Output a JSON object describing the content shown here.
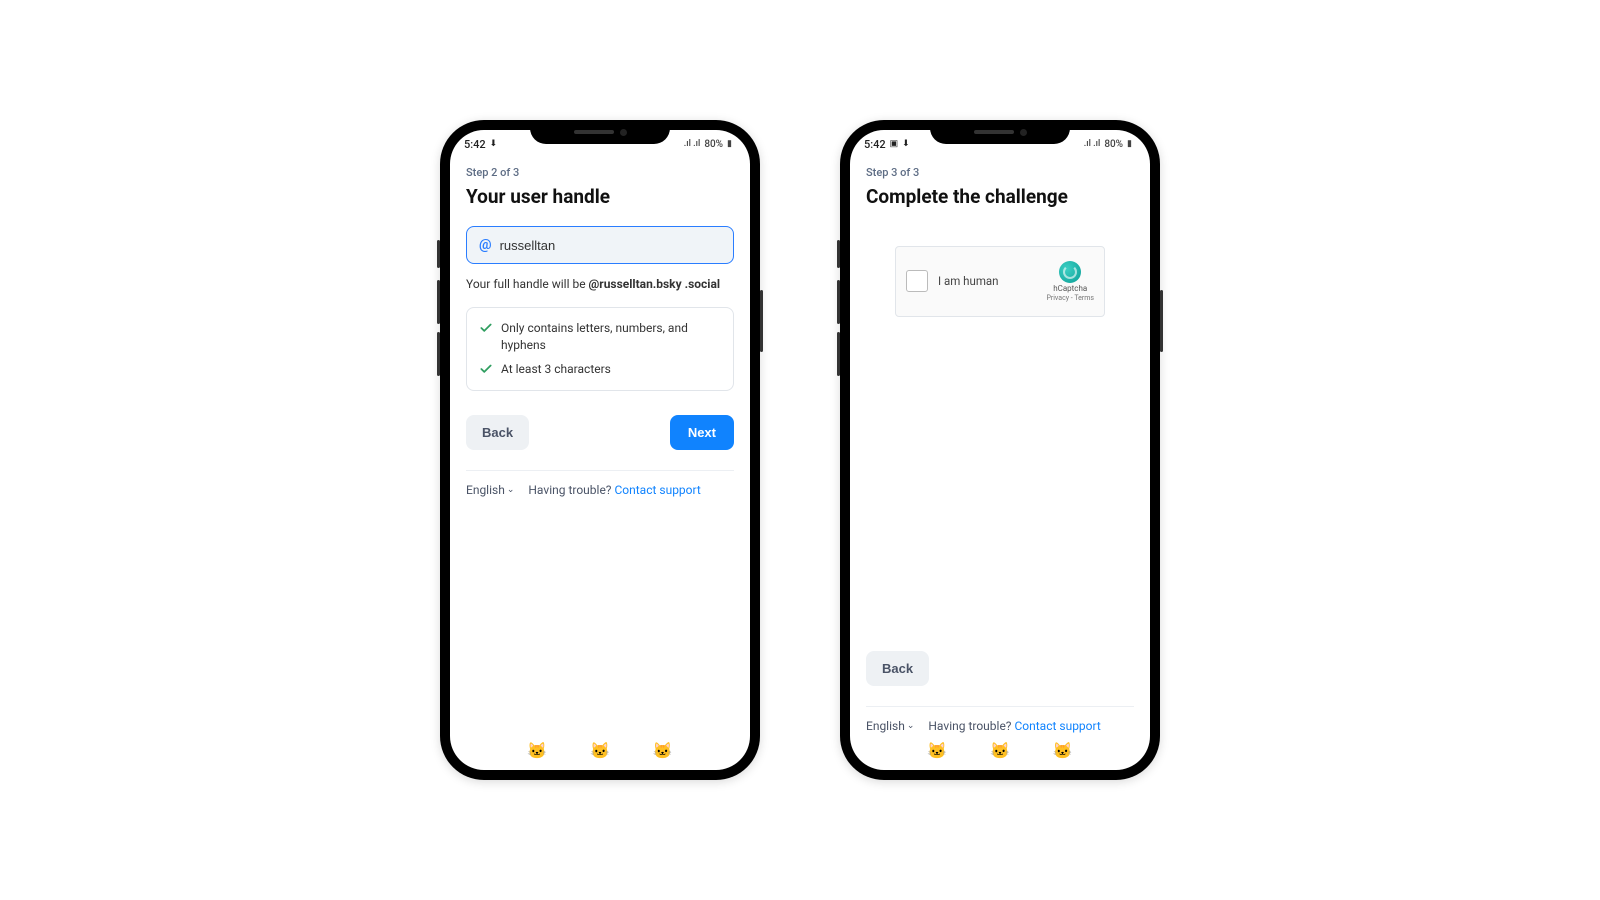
{
  "status": {
    "time": "5:42",
    "signal_text": "80%"
  },
  "left": {
    "step_label": "Step 2 of 3",
    "title": "Your user handle",
    "at_prefix": "@",
    "handle_value": "russelltan",
    "hint_prefix": "Your full handle will be ",
    "hint_handle": "@russelltan.bsky .social",
    "rules": [
      "Only contains letters, numbers, and hyphens",
      "At least 3 characters"
    ],
    "back_label": "Back",
    "next_label": "Next"
  },
  "right": {
    "step_label": "Step 3 of 3",
    "title": "Complete the challenge",
    "captcha_label": "I am human",
    "captcha_brand": "hCaptcha",
    "captcha_links": "Privacy - Terms",
    "back_label": "Back"
  },
  "footer": {
    "language": "English",
    "trouble_text": "Having trouble?",
    "support_link": "Contact support"
  }
}
